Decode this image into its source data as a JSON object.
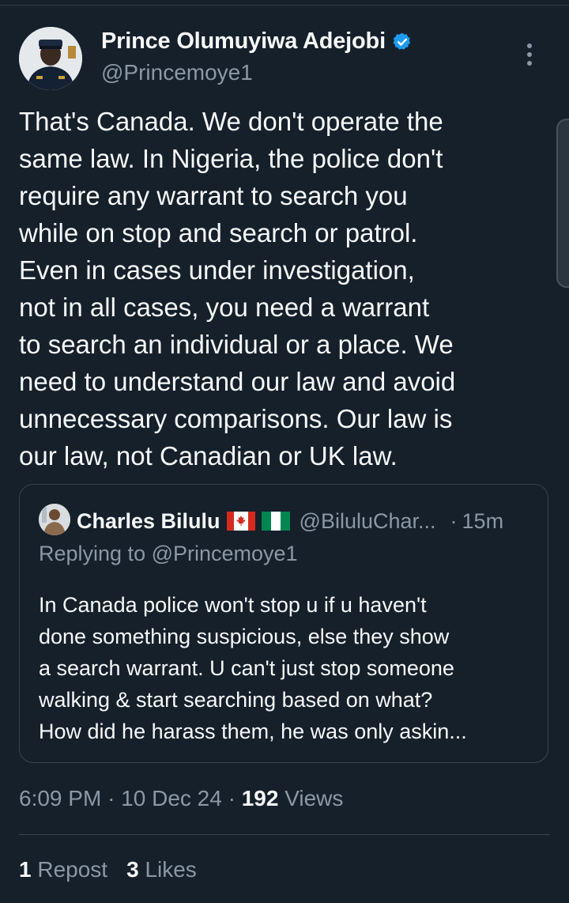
{
  "author": {
    "display_name": "Prince Olumuyiwa Adejobi",
    "handle": "@Princemoye1",
    "verified": true,
    "verified_color": "#1d9bf0"
  },
  "tweet": {
    "text": "That's Canada. We don't operate the\nsame law. In Nigeria, the police don't\nrequire any warrant to search you\nwhile on stop and search or patrol.\nEven in cases under investigation,\nnot in all cases, you need a warrant\nto search an individual or a place. We\nneed to understand our law and avoid\nunnecessary comparisons. Our law is\nour law, not Canadian or UK law."
  },
  "quoted_tweet": {
    "display_name": "Charles Bilulu",
    "flags": [
      "canada-flag-icon",
      "nigeria-flag-icon"
    ],
    "handle": "@BiluluChar...",
    "separator": "·",
    "time": "15m",
    "replying_to": "Replying to @Princemoye1",
    "text": "In Canada police won't stop u if u haven't\ndone something suspicious, else they show\na search warrant. U can't just stop someone\nwalking & start searching based on what?\nHow did he harass them, he was only askin..."
  },
  "meta": {
    "time": "6:09 PM",
    "date": "10 Dec 24",
    "separator": "·",
    "views_count": "192",
    "views_label": "Views"
  },
  "stats": {
    "reposts_count": "1",
    "reposts_label": "Repost",
    "likes_count": "3",
    "likes_label": "Likes"
  },
  "icons": {
    "more": "more-vertical-icon",
    "verified": "verified-badge-icon"
  },
  "colors": {
    "background": "#15202b",
    "primary_text": "#f7f9f9",
    "secondary_text": "#8b98a5",
    "border": "#38444d"
  }
}
